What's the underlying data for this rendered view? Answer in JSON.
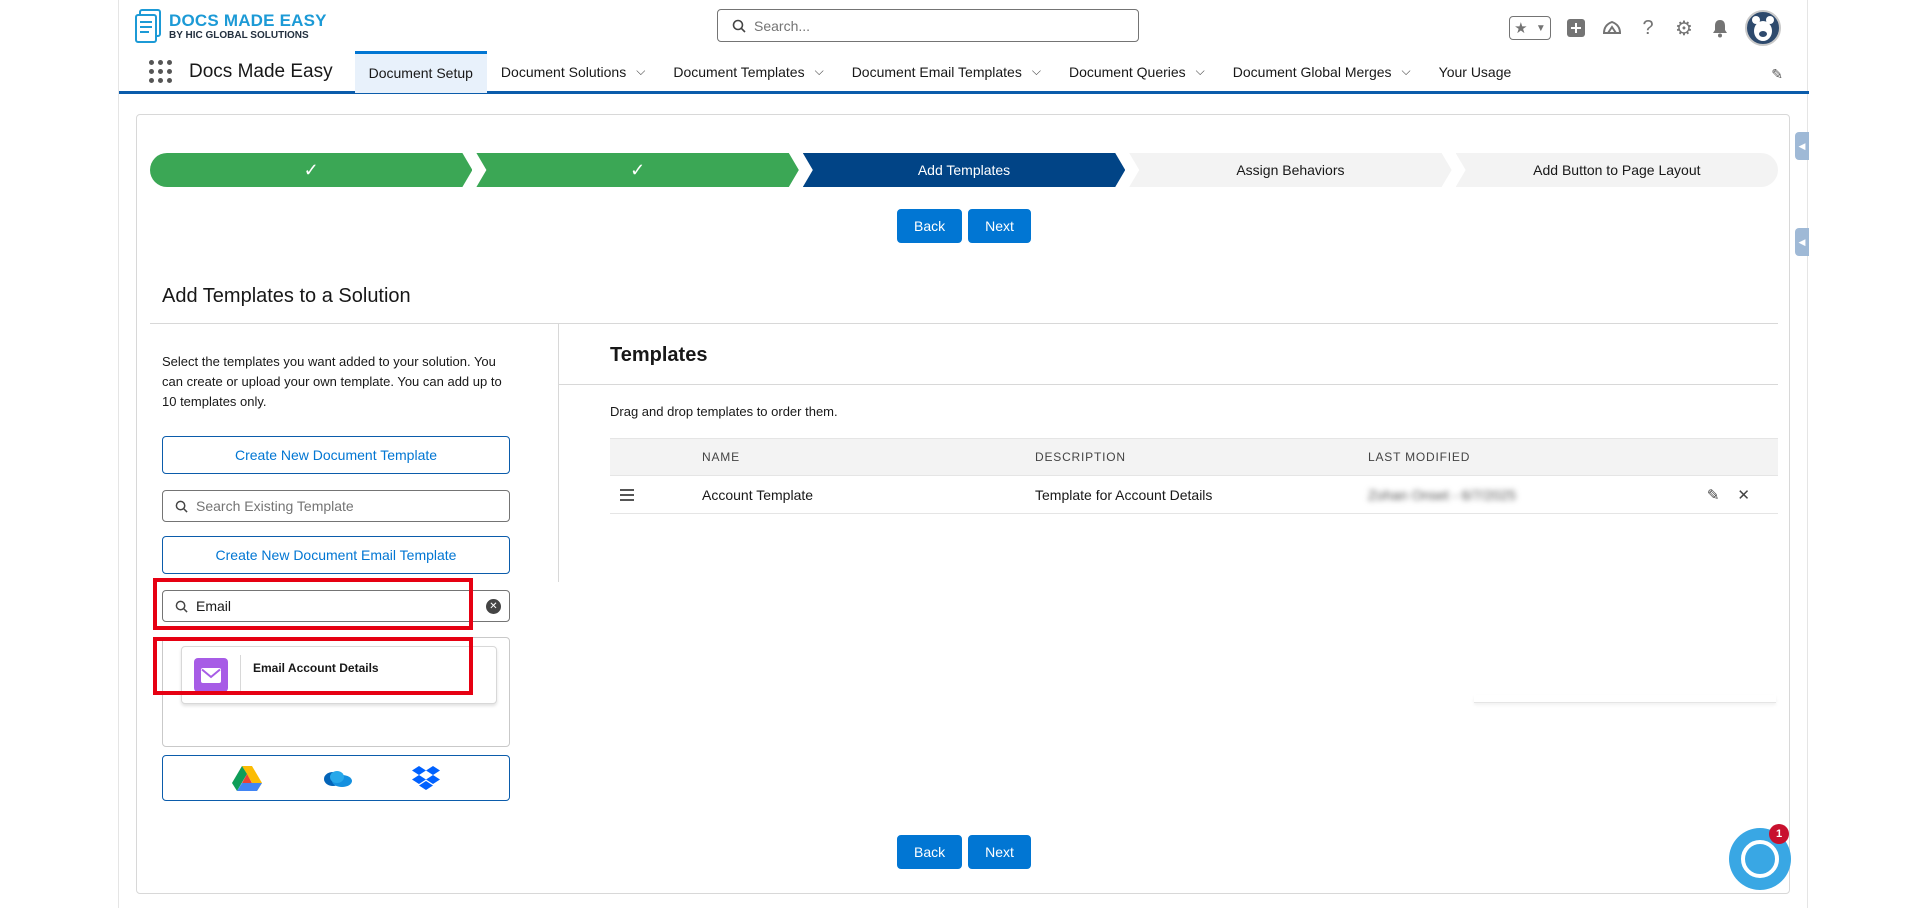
{
  "header": {
    "logo_title": "DOCS MADE EASY",
    "logo_subtitle": "BY HIC GLOBAL SOLUTIONS",
    "search_placeholder": "Search...",
    "icons": [
      "favorites-star-icon",
      "favorites-dropdown-icon",
      "add-icon",
      "trailhead-icon",
      "help-icon",
      "setup-gear-icon",
      "notifications-bell-icon",
      "avatar"
    ]
  },
  "nav": {
    "app_name": "Docs Made Easy",
    "items": [
      {
        "label": "Document Setup",
        "active": true,
        "dropdown": false
      },
      {
        "label": "Document Solutions",
        "active": false,
        "dropdown": true
      },
      {
        "label": "Document Templates",
        "active": false,
        "dropdown": true
      },
      {
        "label": "Document Email Templates",
        "active": false,
        "dropdown": true
      },
      {
        "label": "Document Queries",
        "active": false,
        "dropdown": true
      },
      {
        "label": "Document Global Merges",
        "active": false,
        "dropdown": true
      },
      {
        "label": "Your Usage",
        "active": false,
        "dropdown": false
      }
    ]
  },
  "path": {
    "steps": [
      {
        "label": "✓",
        "state": "done"
      },
      {
        "label": "✓",
        "state": "done"
      },
      {
        "label": "Add Templates",
        "state": "current"
      },
      {
        "label": "Assign Behaviors",
        "state": "todo"
      },
      {
        "label": "Add Button to Page Layout",
        "state": "todo"
      }
    ]
  },
  "buttons": {
    "back": "Back",
    "next": "Next"
  },
  "section_title": "Add Templates to a Solution",
  "left": {
    "instructions": "Select the templates you want added to your solution. You can create or upload your own template. You can add up to 10 templates only.",
    "create_doc_template": "Create New Document Template",
    "search_existing_placeholder": "Search Existing Template",
    "create_email_template": "Create New Document Email Template",
    "email_search_value": "Email",
    "email_result": "Email Account Details",
    "cloud_icons": [
      "google-drive-icon",
      "onedrive-icon",
      "dropbox-icon"
    ]
  },
  "right": {
    "title": "Templates",
    "drag_note": "Drag and drop templates to order them.",
    "columns": [
      "NAME",
      "DESCRIPTION",
      "LAST MODIFIED"
    ],
    "rows": [
      {
        "name": "Account Template",
        "description": "Template for Account Details",
        "last_modified": "Zohan Onset - 6/7/2025"
      }
    ]
  },
  "chat": {
    "badge": "1"
  },
  "colors": {
    "brand_blue": "#0176d3",
    "path_done": "#3ba755",
    "path_current": "#014486",
    "highlight": "#e60012",
    "email_tile": "#a75ce6"
  }
}
